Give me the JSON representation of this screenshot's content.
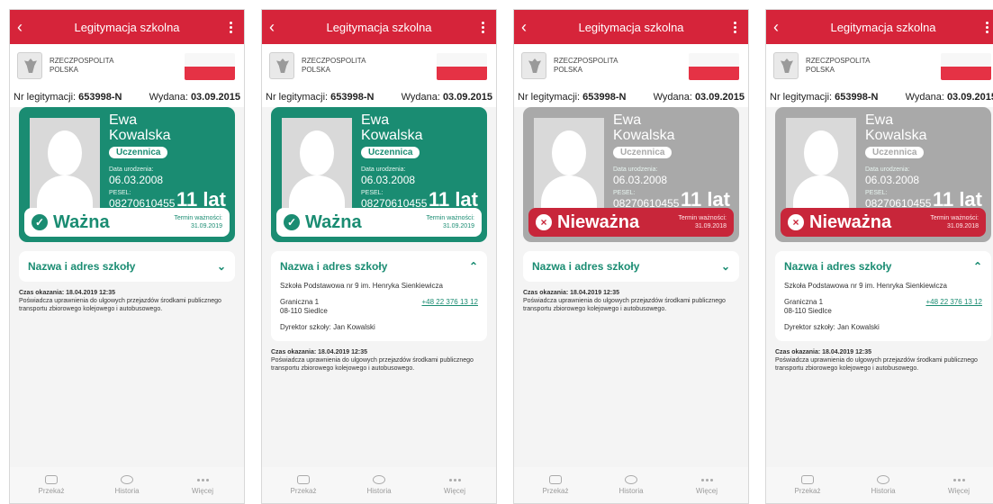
{
  "colors": {
    "red": "#d6243a",
    "green": "#1a8c72",
    "gray": "#a9a9a9"
  },
  "phones": [
    {
      "title": "Legitymacja szkolna",
      "rp": "RZECZPOSPOLITA\nPOLSKA",
      "nr_label": "Nr legitymacji: ",
      "nr": "653998-N",
      "wyd_label": "Wydana: ",
      "wyd": "03.09.2015",
      "first": "Ewa",
      "last": "Kowalska",
      "role": "Uczennica",
      "dob_label": "Data urodzenia:",
      "dob": "06.03.2008",
      "pesel_label": "PESEL:",
      "pesel": "08270610455",
      "age": "11 lat",
      "status": "Ważna",
      "term_label": "Termin ważności:",
      "term": "31.09.2019",
      "section": "Nazwa i adres szkoły",
      "expanded": false,
      "shown_label": "Czas okazania: 18.04.2019 12:35",
      "rights": "Poświadcza uprawnienia do ulgowych przejazdów środkami publicznego transportu zbiorowego kolejowego i autobusowego.",
      "nav": [
        "Przekaż",
        "Historia",
        "Więcej"
      ]
    },
    {
      "title": "Legitymacja szkolna",
      "rp": "RZECZPOSPOLITA\nPOLSKA",
      "nr_label": "Nr legitymacji: ",
      "nr": "653998-N",
      "wyd_label": "Wydana: ",
      "wyd": "03.09.2015",
      "first": "Ewa",
      "last": "Kowalska",
      "role": "Uczennica",
      "dob_label": "Data urodzenia:",
      "dob": "06.03.2008",
      "pesel_label": "PESEL:",
      "pesel": "08270610455",
      "age": "11 lat",
      "status": "Ważna",
      "term_label": "Termin ważności:",
      "term": "31.09.2019",
      "section": "Nazwa i adres szkoły",
      "expanded": true,
      "school": "Szkoła Podstawowa nr 9 im. Henryka Sienkiewicza",
      "addr1": "Graniczna 1",
      "addr2": "08-110 Siedlce",
      "tel": "+48 22 376 13 12",
      "director": "Dyrektor szkoły: Jan Kowalski",
      "shown_label": "Czas okazania: 18.04.2019 12:35",
      "rights": "Poświadcza uprawnienia do ulgowych przejazdów środkami publicznego transportu zbiorowego kolejowego i autobusowego.",
      "nav": [
        "Przekaż",
        "Historia",
        "Więcej"
      ]
    },
    {
      "title": "Legitymacja szkolna",
      "rp": "RZECZPOSPOLITA\nPOLSKA",
      "nr_label": "Nr legitymacji: ",
      "nr": "653998-N",
      "wyd_label": "Wydana: ",
      "wyd": "03.09.2015",
      "first": "Ewa",
      "last": "Kowalska",
      "role": "Uczennica",
      "dob_label": "Data urodzenia:",
      "dob": "06.03.2008",
      "pesel_label": "PESEL:",
      "pesel": "08270610455",
      "age": "11 lat",
      "status": "Nieważna",
      "term_label": "Termin ważności:",
      "term": "31.09.2018",
      "section": "Nazwa i adres szkoły",
      "expanded": false,
      "shown_label": "Czas okazania: 18.04.2019 12:35",
      "rights": "Poświadcza uprawnienia do ulgowych przejazdów środkami publicznego transportu zbiorowego kolejowego i autobusowego.",
      "nav": [
        "Przekaż",
        "Historia",
        "Więcej"
      ]
    },
    {
      "title": "Legitymacja szkolna",
      "rp": "RZECZPOSPOLITA\nPOLSKA",
      "nr_label": "Nr legitymacji: ",
      "nr": "653998-N",
      "wyd_label": "Wydana: ",
      "wyd": "03.09.2015",
      "first": "Ewa",
      "last": "Kowalska",
      "role": "Uczennica",
      "dob_label": "Data urodzenia:",
      "dob": "06.03.2008",
      "pesel_label": "PESEL:",
      "pesel": "08270610455",
      "age": "11 lat",
      "status": "Nieważna",
      "term_label": "Termin ważności:",
      "term": "31.09.2018",
      "section": "Nazwa i adres szkoły",
      "expanded": true,
      "school": "Szkoła Podstawowa nr 9 im. Henryka Sienkiewicza",
      "addr1": "Graniczna 1",
      "addr2": "08-110 Siedlce",
      "tel": "+48 22 376 13 12",
      "director": "Dyrektor szkoły: Jan Kowalski",
      "shown_label": "Czas okazania: 18.04.2019 12:35",
      "rights": "Poświadcza uprawnienia do ulgowych przejazdów środkami publicznego transportu zbiorowego kolejowego i autobusowego.",
      "nav": [
        "Przekaż",
        "Historia",
        "Więcej"
      ]
    }
  ]
}
